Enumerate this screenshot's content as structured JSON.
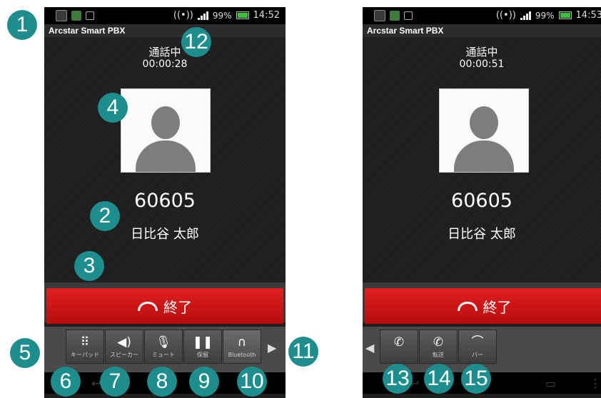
{
  "phone1": {
    "status": {
      "battery": "99%",
      "time": "14:52"
    },
    "app_title": "Arcstar Smart PBX",
    "call_state": "通話中",
    "timer": "00:00:28",
    "number": "60605",
    "name": "日比谷 太郎",
    "end_label": "終了",
    "buttons": [
      {
        "icon": "keypad-icon",
        "glyph": "⠿",
        "label": "キーパッド"
      },
      {
        "icon": "speaker-icon",
        "glyph": "◀)",
        "label": "スピーカー"
      },
      {
        "icon": "mute-icon",
        "glyph": "🎙",
        "label": "ミュート"
      },
      {
        "icon": "hold-icon",
        "glyph": "❚❚",
        "label": "保留"
      },
      {
        "icon": "bluetooth-headphones-icon",
        "glyph": "∩",
        "label": "Bluetooth"
      }
    ],
    "next_arrow": "▶",
    "nav_back": "↩"
  },
  "phone2": {
    "status": {
      "battery": "99%",
      "time": "14:53"
    },
    "app_title": "Arcstar Smart PBX",
    "call_state": "通話中",
    "timer": "00:00:51",
    "number": "60605",
    "name": "日比谷 太郎",
    "end_label": "終了",
    "prev_arrow": "◀",
    "buttons": [
      {
        "icon": "call-transfer-icon",
        "glyph": "✆",
        "label": ""
      },
      {
        "icon": "transfer-icon",
        "glyph": "✆",
        "label": "転送"
      },
      {
        "icon": "park-icon",
        "glyph": "⌒",
        "label": "パー"
      }
    ],
    "nav_back": "↩",
    "nav_home": "⌂",
    "nav_recent": "▭",
    "nav_menu": "⋮"
  },
  "badges": [
    "1",
    "2",
    "3",
    "4",
    "5",
    "6",
    "7",
    "8",
    "9",
    "10",
    "11",
    "12",
    "13",
    "14",
    "15"
  ],
  "colors": {
    "badge": "#1e8d8d",
    "end_button": "#d01818"
  }
}
